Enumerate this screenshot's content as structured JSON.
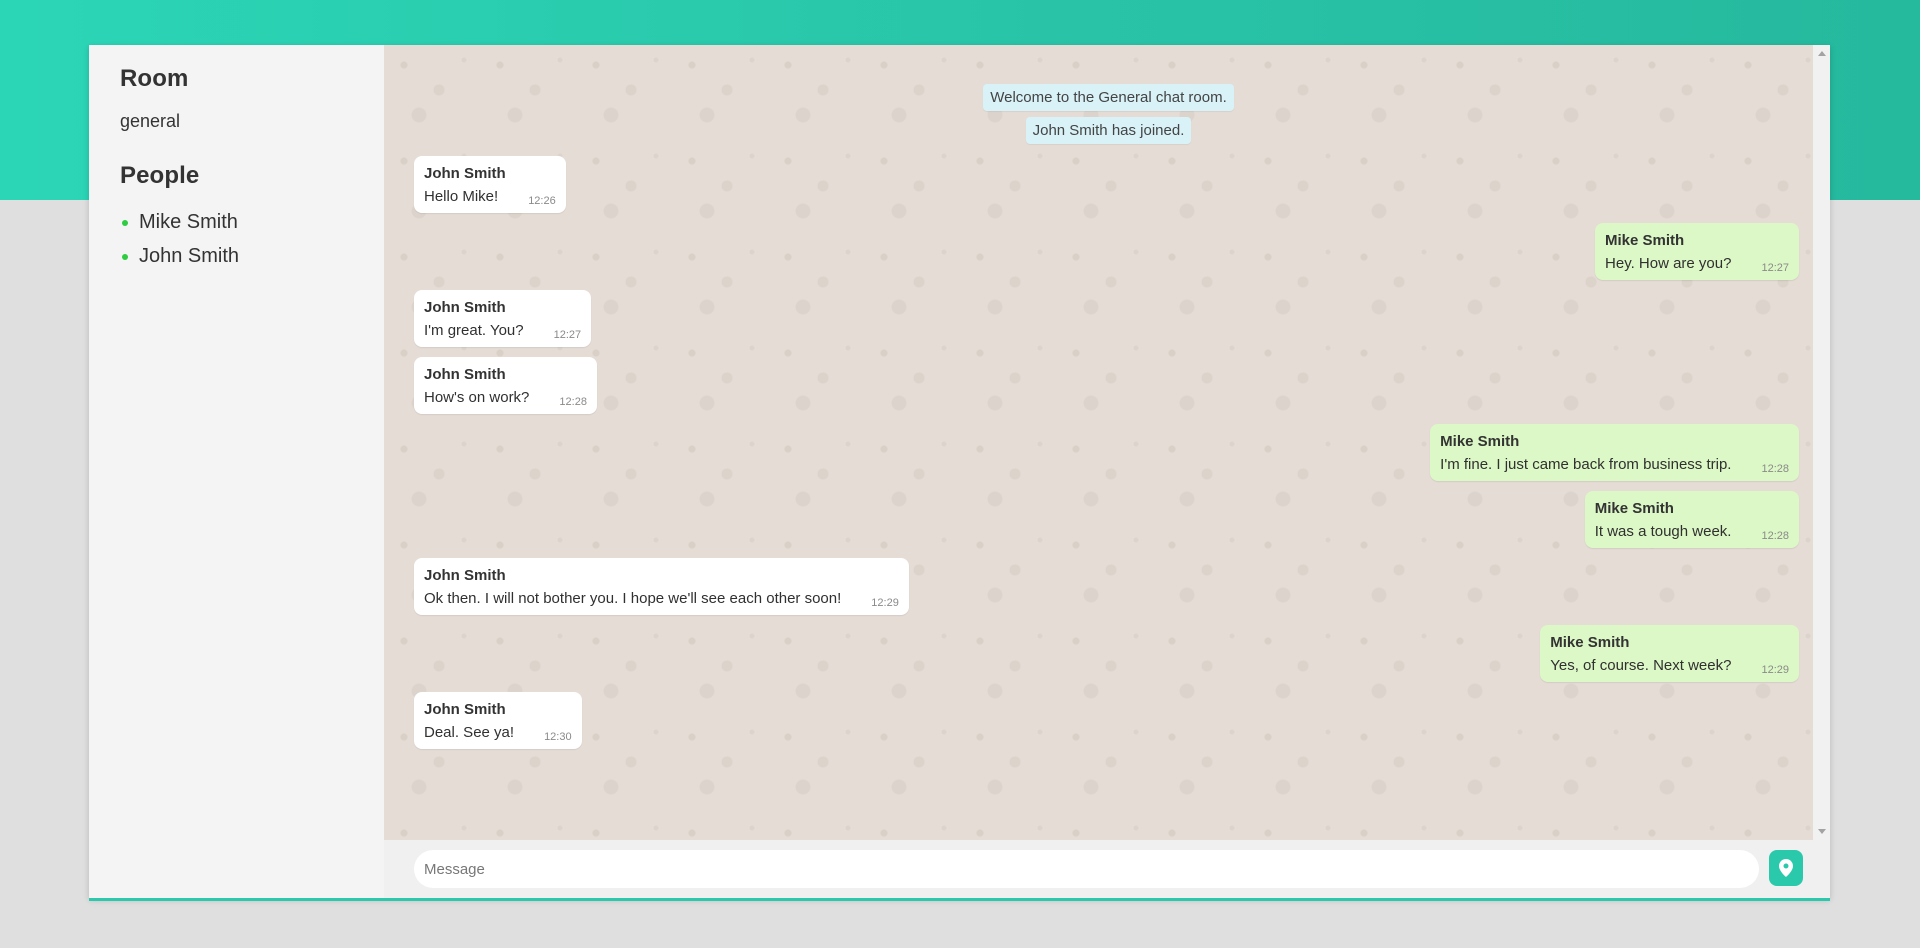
{
  "sidebar": {
    "room_heading": "Room",
    "room_name": "general",
    "people_heading": "People",
    "people": [
      "Mike Smith",
      "John Smith"
    ]
  },
  "system_messages": [
    "Welcome to the General chat room.",
    "John Smith has joined."
  ],
  "messages": [
    {
      "sender": "John Smith",
      "text": "Hello Mike!",
      "time": "12:26",
      "direction": "incoming"
    },
    {
      "sender": "Mike Smith",
      "text": "Hey. How are you?",
      "time": "12:27",
      "direction": "outgoing"
    },
    {
      "sender": "John Smith",
      "text": "I'm great. You?",
      "time": "12:27",
      "direction": "incoming"
    },
    {
      "sender": "John Smith",
      "text": "How's on work?",
      "time": "12:28",
      "direction": "incoming"
    },
    {
      "sender": "Mike Smith",
      "text": "I'm fine. I just came back from business trip.",
      "time": "12:28",
      "direction": "outgoing"
    },
    {
      "sender": "Mike Smith",
      "text": "It was a tough week.",
      "time": "12:28",
      "direction": "outgoing"
    },
    {
      "sender": "John Smith",
      "text": "Ok then. I will not bother you. I hope we'll see each other soon!",
      "time": "12:29",
      "direction": "incoming"
    },
    {
      "sender": "Mike Smith",
      "text": "Yes, of course. Next week?",
      "time": "12:29",
      "direction": "outgoing"
    },
    {
      "sender": "John Smith",
      "text": "Deal. See ya!",
      "time": "12:30",
      "direction": "incoming"
    }
  ],
  "composer": {
    "placeholder": "Message",
    "value": "",
    "send_location_icon": "map-pin-icon"
  },
  "colors": {
    "accent": "#2bc9ab",
    "incoming_bubble": "#ffffff",
    "outgoing_bubble": "#dcf8c6",
    "system_bubble": "#d8f2f7",
    "online_dot": "#2ecc40"
  }
}
